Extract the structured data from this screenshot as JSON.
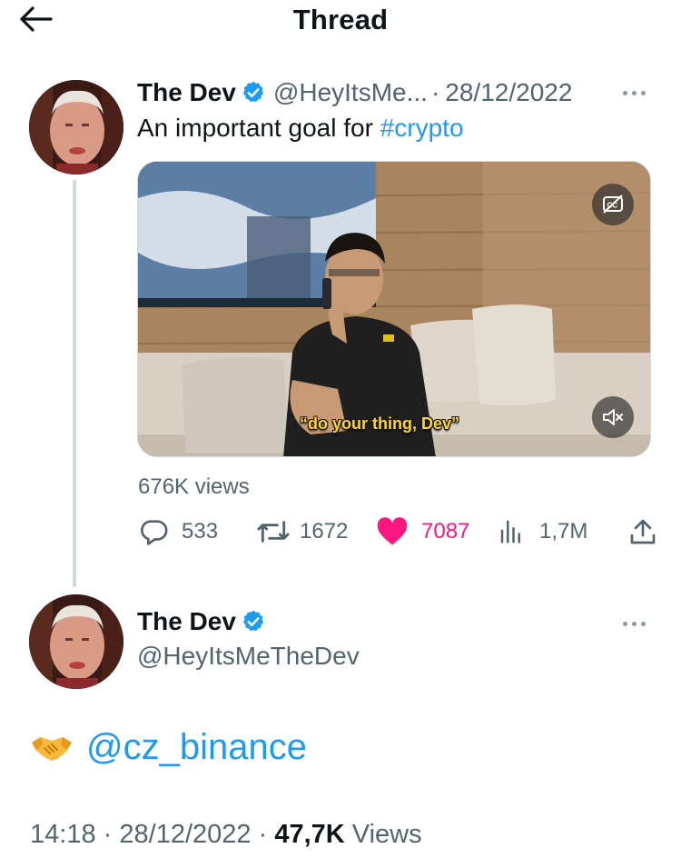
{
  "header": {
    "title": "Thread"
  },
  "colors": {
    "accent": "#1d9bf0",
    "like": "#f91880",
    "text": "#0f1419",
    "muted": "#536471"
  },
  "tweet1": {
    "name": "The Dev",
    "handle": "@HeyItsMe...",
    "separator": "·",
    "date": "28/12/2022",
    "text_prefix": "An important goal for ",
    "hashtag": "#crypto",
    "media": {
      "subtitle": "“do your thing, Dev”",
      "cc_icon": "closed-captions-icon",
      "mute_icon": "volume-muted-icon"
    },
    "views": "676K views",
    "stats": {
      "replies": "533",
      "retweets": "1672",
      "likes": "7087",
      "analytics": "1,7M"
    }
  },
  "tweet2": {
    "name": "The Dev",
    "handle": "@HeyItsMeTheDev",
    "emoji": "handshake-icon",
    "mention": "@cz_binance",
    "time": "14:18",
    "sep1": "·",
    "date": "28/12/2022",
    "sep2": "·",
    "view_count": "47,7K",
    "view_label": "Views"
  }
}
